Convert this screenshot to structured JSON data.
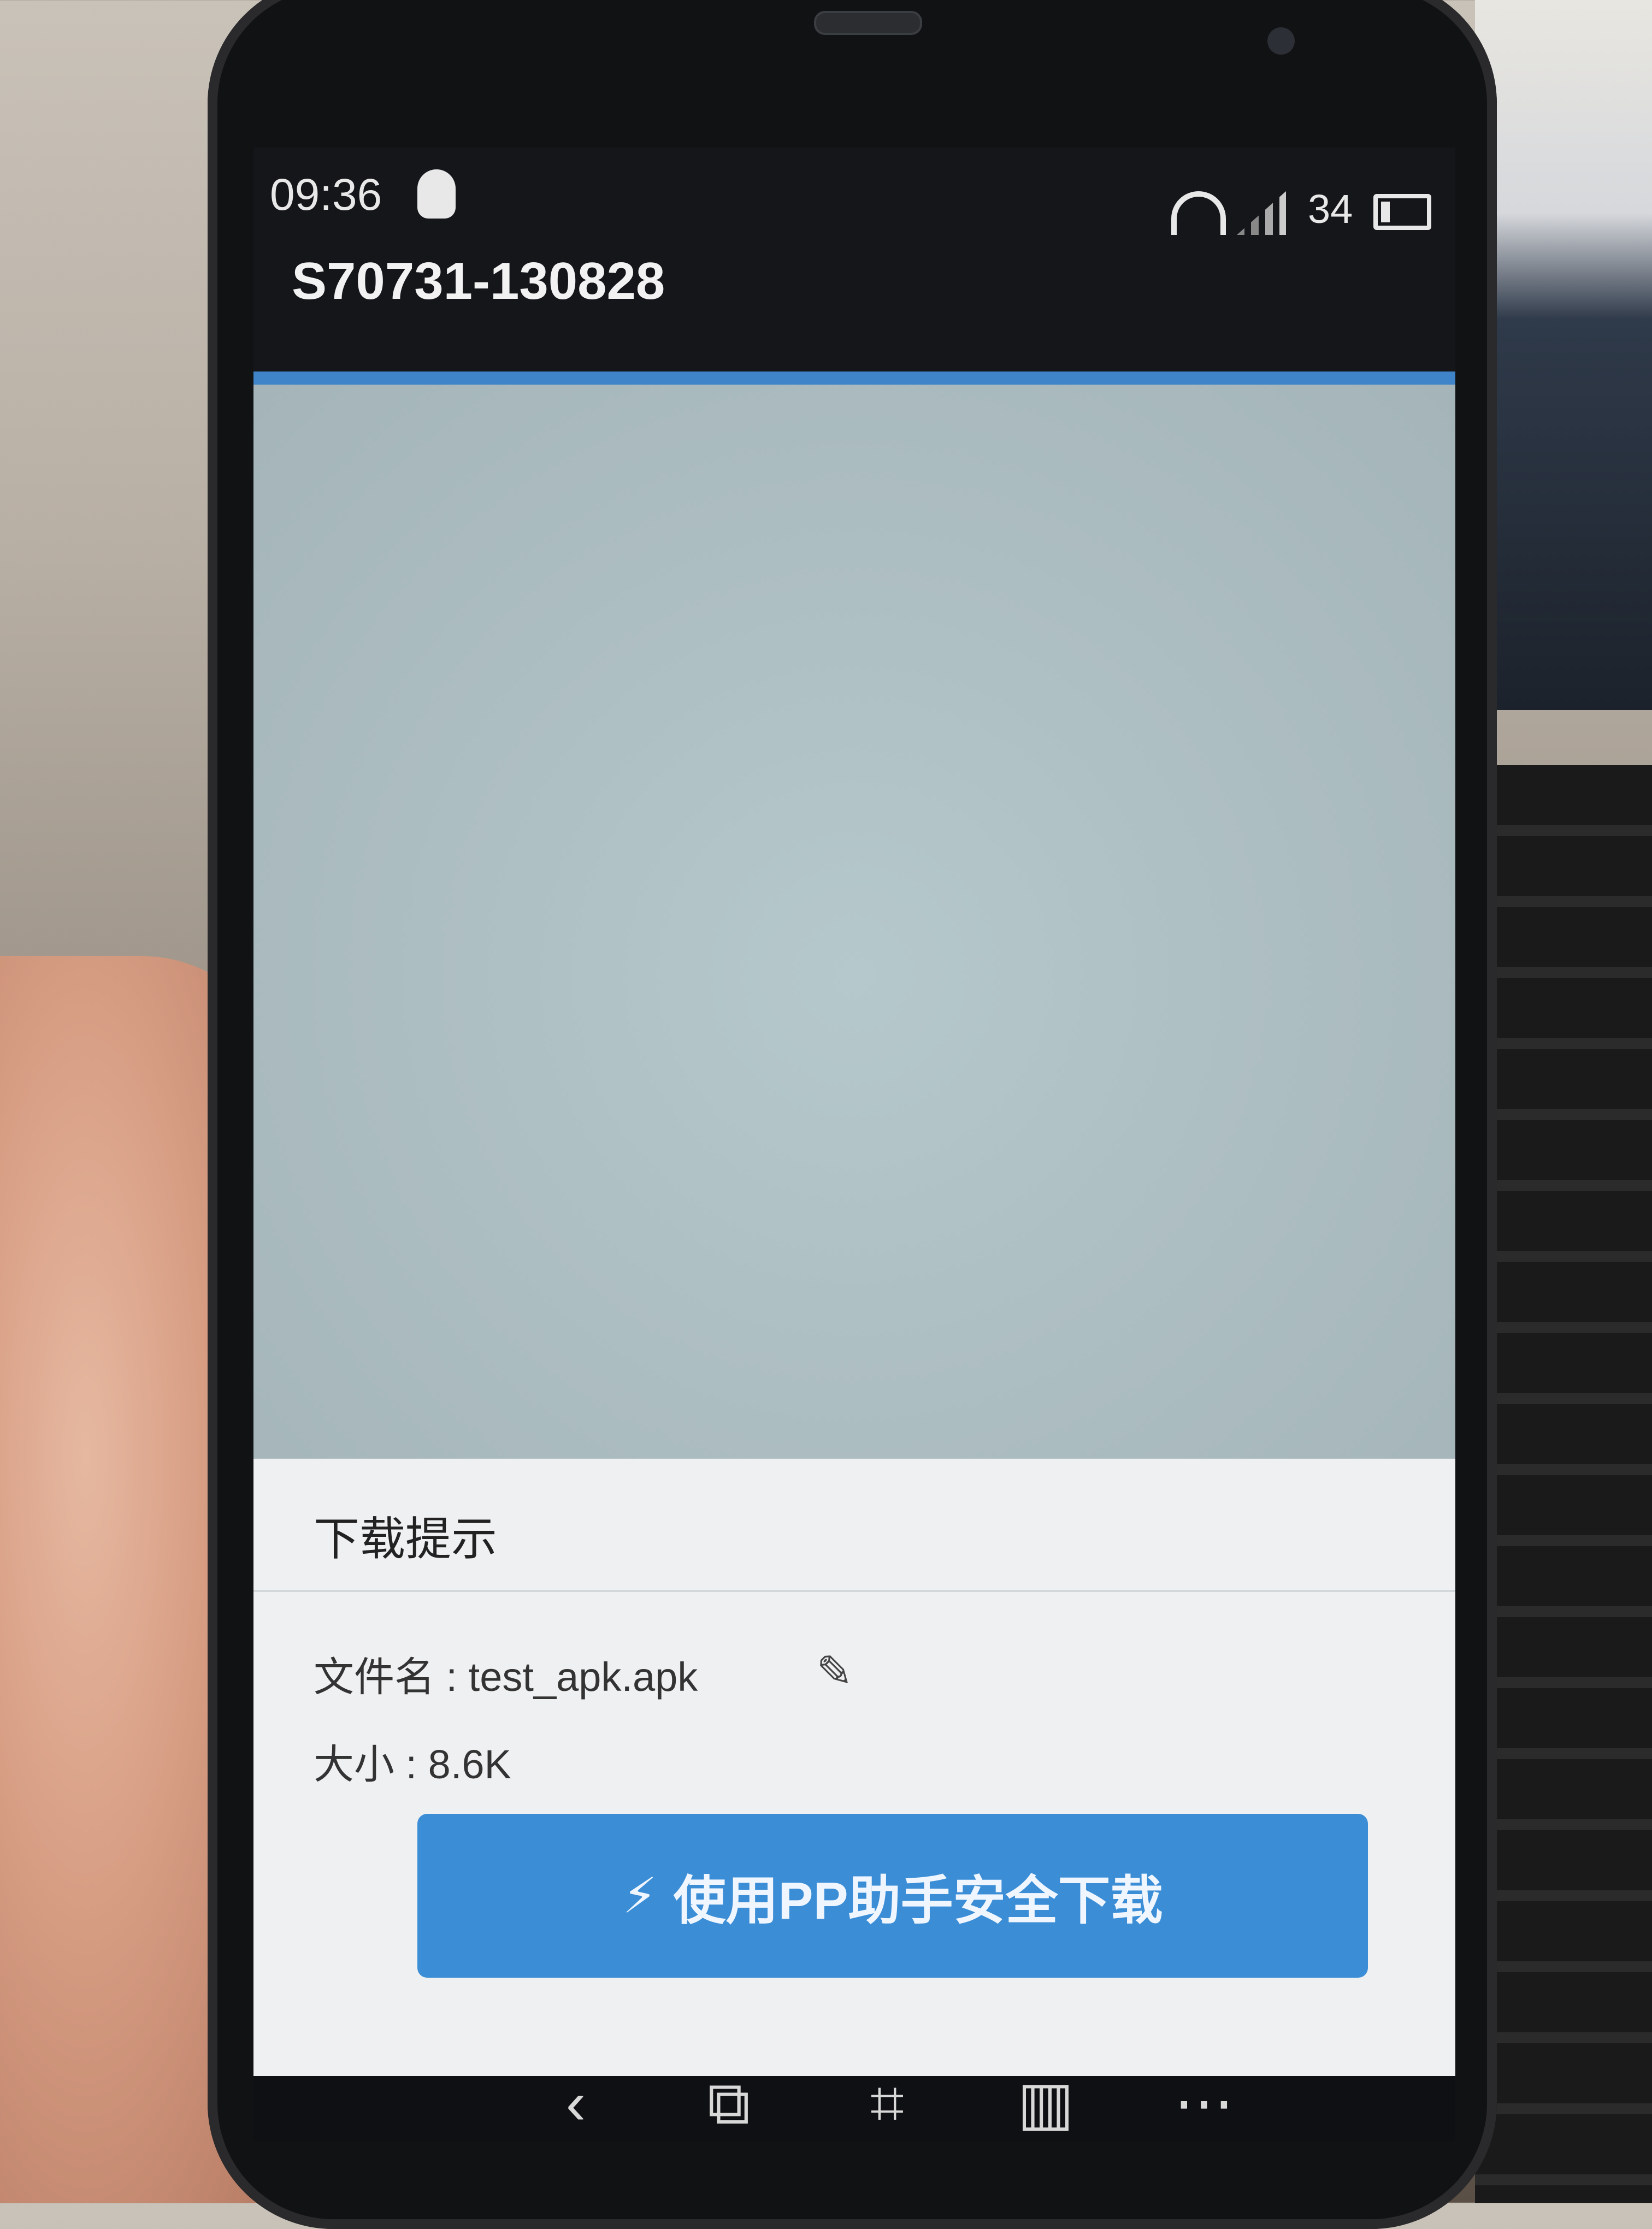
{
  "status_bar": {
    "time": "09:36",
    "battery_level": "34"
  },
  "header": {
    "title": "S70731-130828"
  },
  "dialog": {
    "title": "下载提示",
    "file_label": "文件名 : test_apk.apk",
    "size_label": "大小 : 8.6K",
    "download_button_label": "使用PP助手安全下载"
  },
  "icons": {
    "notification": "qq-icon",
    "wifi": "wifi-icon",
    "signal": "signal-icon",
    "battery": "battery-icon",
    "edit": "pencil-icon",
    "bolt": "bolt-icon",
    "nav": [
      "back-icon",
      "share-icon",
      "crop-icon",
      "delete-icon",
      "more-icon"
    ]
  },
  "colors": {
    "accent": "#3f84c8",
    "button": "#3b8ed6"
  }
}
